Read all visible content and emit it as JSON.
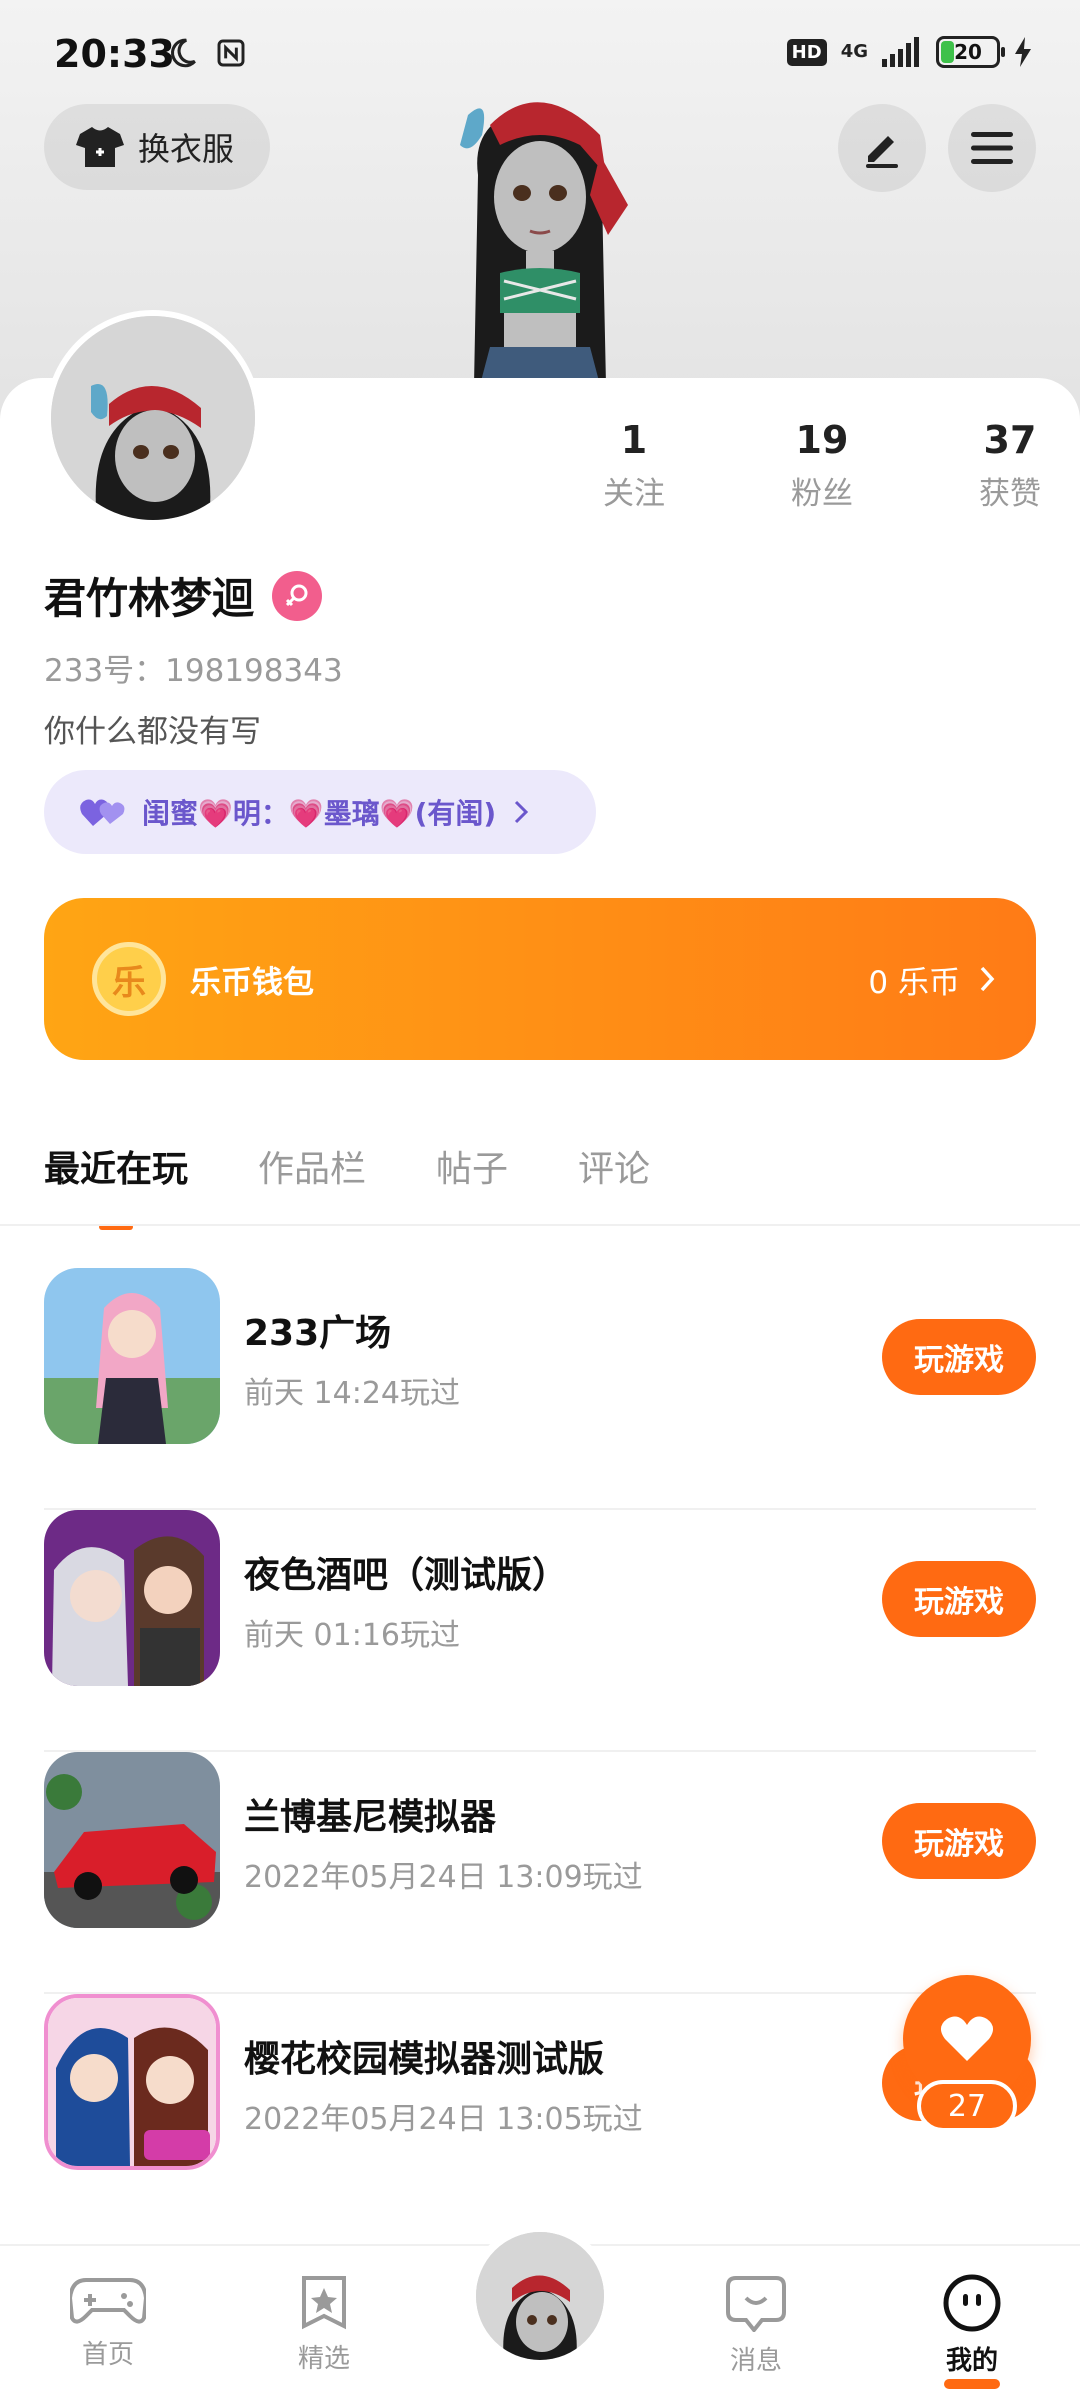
{
  "status_bar": {
    "time": "20:33",
    "network": "4G",
    "hd": "HD",
    "battery": "20"
  },
  "header": {
    "outfit_label": "换衣服"
  },
  "profile": {
    "stats": [
      {
        "value": "1",
        "label": "关注"
      },
      {
        "value": "19",
        "label": "粉丝"
      },
      {
        "value": "37",
        "label": "获赞"
      }
    ],
    "username": "君竹林梦迴",
    "user_id": "233号：198198343",
    "bio": "你什么都没有写",
    "relation": "闺蜜💗明：💗墨璃💗(有闺)"
  },
  "wallet": {
    "coin_glyph": "乐",
    "title": "乐币钱包",
    "balance": "0 乐币"
  },
  "tabs": [
    {
      "label": "最近在玩",
      "active": true
    },
    {
      "label": "作品栏",
      "active": false
    },
    {
      "label": "帖子",
      "active": false
    },
    {
      "label": "评论",
      "active": false
    }
  ],
  "games": [
    {
      "name": "233广场",
      "played": "前天 14:24玩过",
      "button": "玩游戏"
    },
    {
      "name": "夜色酒吧（测试版）",
      "played": "前天 01:16玩过",
      "button": "玩游戏"
    },
    {
      "name": "兰博基尼模拟器",
      "played": "2022年05月24日 13:09玩过",
      "button": "玩游戏"
    },
    {
      "name": "樱花校园模拟器测试版",
      "played": "2022年05月24日 13:05玩过",
      "button": "玩游戏"
    }
  ],
  "like_count": "27",
  "bottom_nav": [
    {
      "label": "首页",
      "icon": "gamepad-icon"
    },
    {
      "label": "精选",
      "icon": "star-icon"
    },
    {
      "label": "",
      "icon": "avatar"
    },
    {
      "label": "消息",
      "icon": "chat-icon"
    },
    {
      "label": "我的",
      "icon": "face-icon",
      "active": true
    }
  ],
  "colors": {
    "accent": "#ff6a12",
    "wallet_start": "#ffa514",
    "wallet_end": "#ff7b16",
    "relation_text": "#6b57cc",
    "gender_badge": "#f25e8d"
  }
}
